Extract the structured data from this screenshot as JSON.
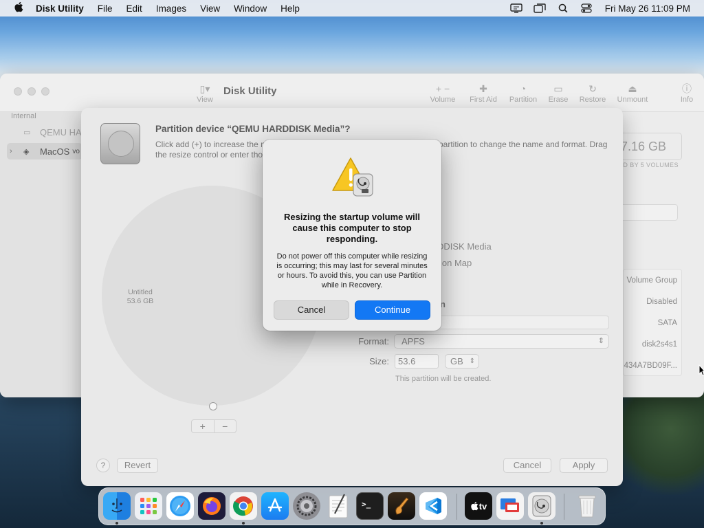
{
  "menubar": {
    "app_name": "Disk Utility",
    "menus": [
      "File",
      "Edit",
      "Images",
      "View",
      "Window",
      "Help"
    ],
    "clock": "Fri May 26  11:09 PM"
  },
  "window": {
    "title": "Disk Utility",
    "view_label": "View",
    "toolbar": [
      {
        "label": "Volume",
        "icon": "+ −"
      },
      {
        "label": "First Aid",
        "icon": "✚"
      },
      {
        "label": "Partition",
        "icon": "◔"
      },
      {
        "label": "Erase",
        "icon": "▭"
      },
      {
        "label": "Restore",
        "icon": "↻"
      },
      {
        "label": "Unmount",
        "icon": "⏏"
      },
      {
        "label": "Info",
        "icon": "ⓘ"
      }
    ],
    "sidebar": {
      "header": "Internal",
      "items": [
        {
          "label": "QEMU HA",
          "icon": "disk-icon"
        },
        {
          "label": "MacOS",
          "suffix": "vo",
          "icon": "stack-icon"
        }
      ]
    },
    "capacity": "07.16 GB",
    "capacity_sub": "ED BY 5 VOLUMES",
    "info_values": [
      "Volume Group",
      "Disabled",
      "SATA",
      "disk2s4s1",
      "434A7BD09F..."
    ]
  },
  "sheet": {
    "title": "Partition device “QEMU HARDDISK Media”?",
    "desc_line1_left": "Click add (+) to increase the n",
    "desc_line1_right": "partition to change the name and format. Drag",
    "desc_line2": "the resize control or enter tho",
    "pie_label_name": "Untitled",
    "pie_label_size": "53.6 GB",
    "info_media": "DDISK Media",
    "info_scheme": "ion Map",
    "name_label_frag": "n",
    "format_label": "Format:",
    "format_value": "APFS",
    "size_label": "Size:",
    "size_value": "53.6",
    "size_unit": "GB",
    "size_note": "This partition will be created.",
    "help": "?",
    "revert": "Revert",
    "cancel": "Cancel",
    "apply": "Apply",
    "add": "+",
    "remove": "−"
  },
  "alert": {
    "title": "Resizing the startup volume will cause this computer to stop responding.",
    "message": "Do not power off this computer while resizing is occurring; this may last for several minutes or hours. To avoid this, you can use Partition while in Recovery.",
    "cancel": "Cancel",
    "continue": "Continue",
    "accent": "#1378f4"
  },
  "dock": {
    "apps": [
      "finder",
      "launchpad",
      "safari",
      "firefox",
      "chrome",
      "app-store",
      "system-preferences",
      "textedit",
      "terminal",
      "garageband",
      "vscode",
      "apple-tv",
      "remote-desktop",
      "disk-utility",
      "trash"
    ],
    "tv_label": "tv"
  }
}
